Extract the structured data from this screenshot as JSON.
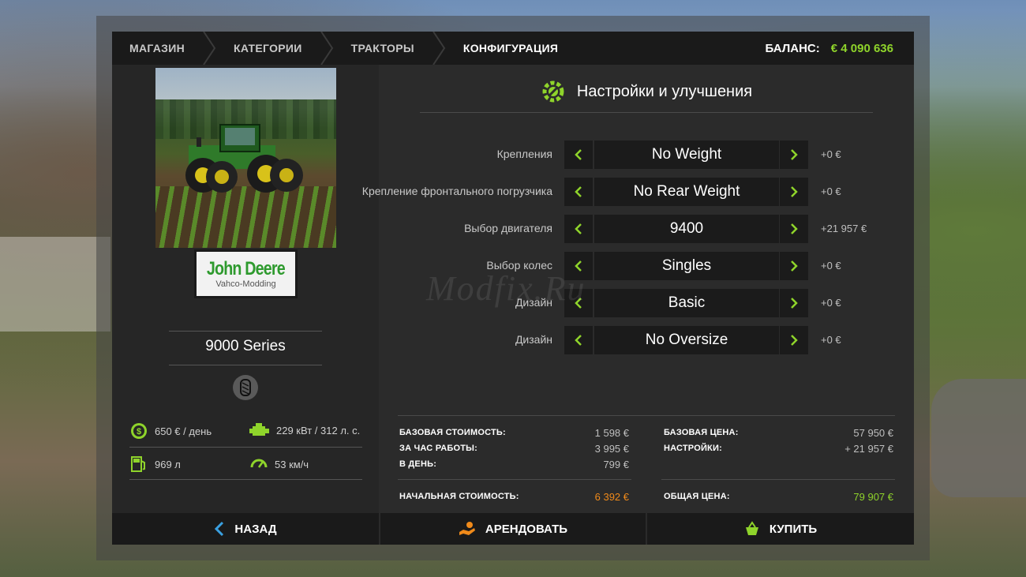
{
  "breadcrumbs": [
    "МАГАЗИН",
    "КАТЕГОРИИ",
    "ТРАКТОРЫ",
    "КОНФИГУРАЦИЯ"
  ],
  "balance": {
    "label": "БАЛАНС:",
    "value": "€ 4 090 636"
  },
  "vehicle": {
    "brand": "John Deere",
    "brand_sub": "Vahco-Modding",
    "model": "9000 Series",
    "stats": {
      "rent_per_day": "650 € / день",
      "power": "229 кВт / 312 л. с.",
      "fuel": "969 л",
      "speed": "53 км/ч"
    }
  },
  "config": {
    "title": "Настройки и улучшения",
    "rows": [
      {
        "label": "Крепления",
        "value": "No Weight",
        "price": "+0 €"
      },
      {
        "label": "Крепление фронтального погрузчика",
        "value": "No Rear Weight",
        "price": "+0 €"
      },
      {
        "label": "Выбор двигателя",
        "value": "9400",
        "price": "+21 957 €"
      },
      {
        "label": "Выбор колес",
        "value": "Singles",
        "price": "+0 €"
      },
      {
        "label": "Дизайн",
        "value": "Basic",
        "price": "+0 €"
      },
      {
        "label": "Дизайн",
        "value": "No Oversize",
        "price": "+0 €"
      }
    ]
  },
  "costs": {
    "lease": [
      {
        "label": "БАЗОВАЯ СТОИМОСТЬ:",
        "value": "1 598 €"
      },
      {
        "label": "ЗА ЧАС РАБОТЫ:",
        "value": "3 995 €"
      },
      {
        "label": "В ДЕНЬ:",
        "value": "799 €"
      }
    ],
    "lease_total": {
      "label": "НАЧАЛЬНАЯ СТОИМОСТЬ:",
      "value": "6 392 €"
    },
    "buy": [
      {
        "label": "БАЗОВАЯ ЦЕНА:",
        "value": "57 950 €"
      },
      {
        "label": "НАСТРОЙКИ:",
        "value": "+ 21 957 €"
      }
    ],
    "buy_total": {
      "label": "ОБЩАЯ ЦЕНА:",
      "value": "79 907 €"
    }
  },
  "actions": {
    "back": "НАЗАД",
    "lease": "АРЕНДОВАТЬ",
    "buy": "КУПИТЬ"
  },
  "watermark": "Modfix.Ru",
  "colors": {
    "accent_green": "#8fd42b",
    "accent_orange": "#f08a1a",
    "panel": "#2b2b2b",
    "bar": "#1a1a1a"
  }
}
